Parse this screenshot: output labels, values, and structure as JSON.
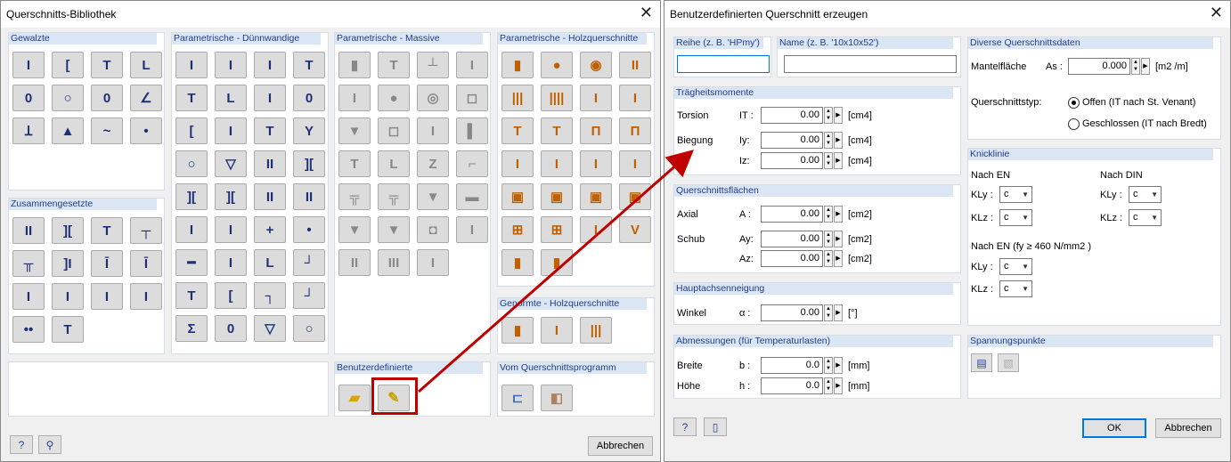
{
  "left": {
    "title": "Querschnitts-Bibliothek",
    "groups": {
      "gewalzte": "Gewalzte",
      "zusammengesetzte": "Zusammengesetzte",
      "duennwandige": "Parametrische - Dünnwandige",
      "massive": "Parametrische - Massive",
      "holz": "Parametrische - Holzquerschnitte",
      "benutzer": "Benutzerdefinierte",
      "genormte": "Genormte - Holzquerschnitte",
      "programm": "Vom Querschnittsprogramm"
    },
    "icons": {
      "gewalzte": [
        "I",
        "[",
        "T",
        "L",
        "0",
        "○",
        "0",
        "∠",
        "Ʇ",
        "▲",
        "~",
        "•"
      ],
      "zusammengesetzte": [
        "II",
        "][",
        "T",
        "┬",
        "╥",
        "]I",
        "Ī",
        "Ī",
        "I",
        "I",
        "I",
        "I",
        "••",
        "T"
      ],
      "duennwandige": [
        "I",
        "I",
        "I",
        "T",
        "T",
        "L",
        "I",
        "0",
        "[",
        "I",
        "T",
        "Y",
        "○",
        "▽",
        "II",
        "][",
        "][",
        "][",
        "II",
        "II",
        "I",
        "I",
        "+",
        "•",
        "━",
        "I",
        "L",
        "┘",
        "T",
        "[",
        "┐",
        "┘",
        "Σ",
        "0",
        "▽",
        "○"
      ],
      "massive": [
        "▮",
        "T",
        "┴",
        "I",
        "I",
        "●",
        "◎",
        "◻",
        "▼",
        "◻",
        "I",
        "▌",
        "T",
        "L",
        "Z",
        "⌐",
        "╦",
        "╦",
        "▼",
        "▬",
        "▼",
        "▼",
        "◘",
        "I",
        "II",
        "III",
        "I"
      ],
      "holz": [
        "▮",
        "●",
        "◉",
        "II",
        "|||",
        "||||",
        "I",
        "I",
        "T",
        "T",
        "Π",
        "Π",
        "I",
        "I",
        "I",
        "I",
        "▣",
        "▣",
        "▣",
        "▣",
        "⊞",
        "⊞",
        "I",
        "V",
        "▮",
        "▮"
      ],
      "genormte": [
        "▮",
        "I",
        "|||"
      ],
      "benutzer": [
        "folder-open",
        "edit"
      ],
      "programm": [
        "section-program",
        "cube"
      ]
    },
    "cancel": "Abbrechen"
  },
  "right": {
    "title": "Benutzerdefinierten Querschnitt erzeugen",
    "reihe_label": "Reihe (z. B. 'HPmy')",
    "name_label": "Name  (z. B. '10x10x52')",
    "traeg": {
      "title": "Trägheitsmomente",
      "torsion": "Torsion",
      "torsion_sym": "IT :",
      "torsion_val": "0.00",
      "torsion_unit": "[cm4]",
      "biegung": "Biegung",
      "iy_sym": "Iy:",
      "iy_val": "0.00",
      "iy_unit": "[cm4]",
      "iz_sym": "Iz:",
      "iz_val": "0.00",
      "iz_unit": "[cm4]"
    },
    "flaechen": {
      "title": "Querschnittsflächen",
      "axial": "Axial",
      "a_sym": "A :",
      "a_val": "0.00",
      "a_unit": "[cm2]",
      "schub": "Schub",
      "ay_sym": "Ay:",
      "ay_val": "0.00",
      "ay_unit": "[cm2]",
      "az_sym": "Az:",
      "az_val": "0.00",
      "az_unit": "[cm2]"
    },
    "neigung": {
      "title": "Hauptachsenneigung",
      "winkel": "Winkel",
      "alpha_sym": "α :",
      "alpha_val": "0.00",
      "alpha_unit": "[°]"
    },
    "abm": {
      "title": "Abmessungen (für Temperaturlasten)",
      "breite": "Breite",
      "b_sym": "b :",
      "b_val": "0.0",
      "b_unit": "[mm]",
      "hoehe": "Höhe",
      "h_sym": "h :",
      "h_val": "0.0",
      "h_unit": "[mm]"
    },
    "diverse": {
      "title": "Diverse Querschnittsdaten",
      "mantel": "Mantelfläche",
      "as_sym": "As :",
      "as_val": "0.000",
      "as_unit": "[m2 /m]",
      "typ": "Querschnittstyp:",
      "offen": "Offen (IT nach St. Venant)",
      "geschlossen": "Geschlossen (IT nach Bredt)"
    },
    "knick": {
      "title": "Knicklinie",
      "nach_en": "Nach EN",
      "nach_din": "Nach DIN",
      "kly": "KLy :",
      "klz": "KLz :",
      "en_kly": "c",
      "en_klz": "c",
      "din_kly": "c",
      "din_klz": "c",
      "nach_en460": "Nach EN (fy ≥ 460 N/mm2 )",
      "en460_kly": "c",
      "en460_klz": "c"
    },
    "spann": {
      "title": "Spannungspunkte"
    },
    "ok": "OK",
    "cancel": "Abbrechen"
  },
  "colors": {
    "accent": "#c00000",
    "header": "#dbe6f4",
    "header_text": "#1f3c88"
  }
}
